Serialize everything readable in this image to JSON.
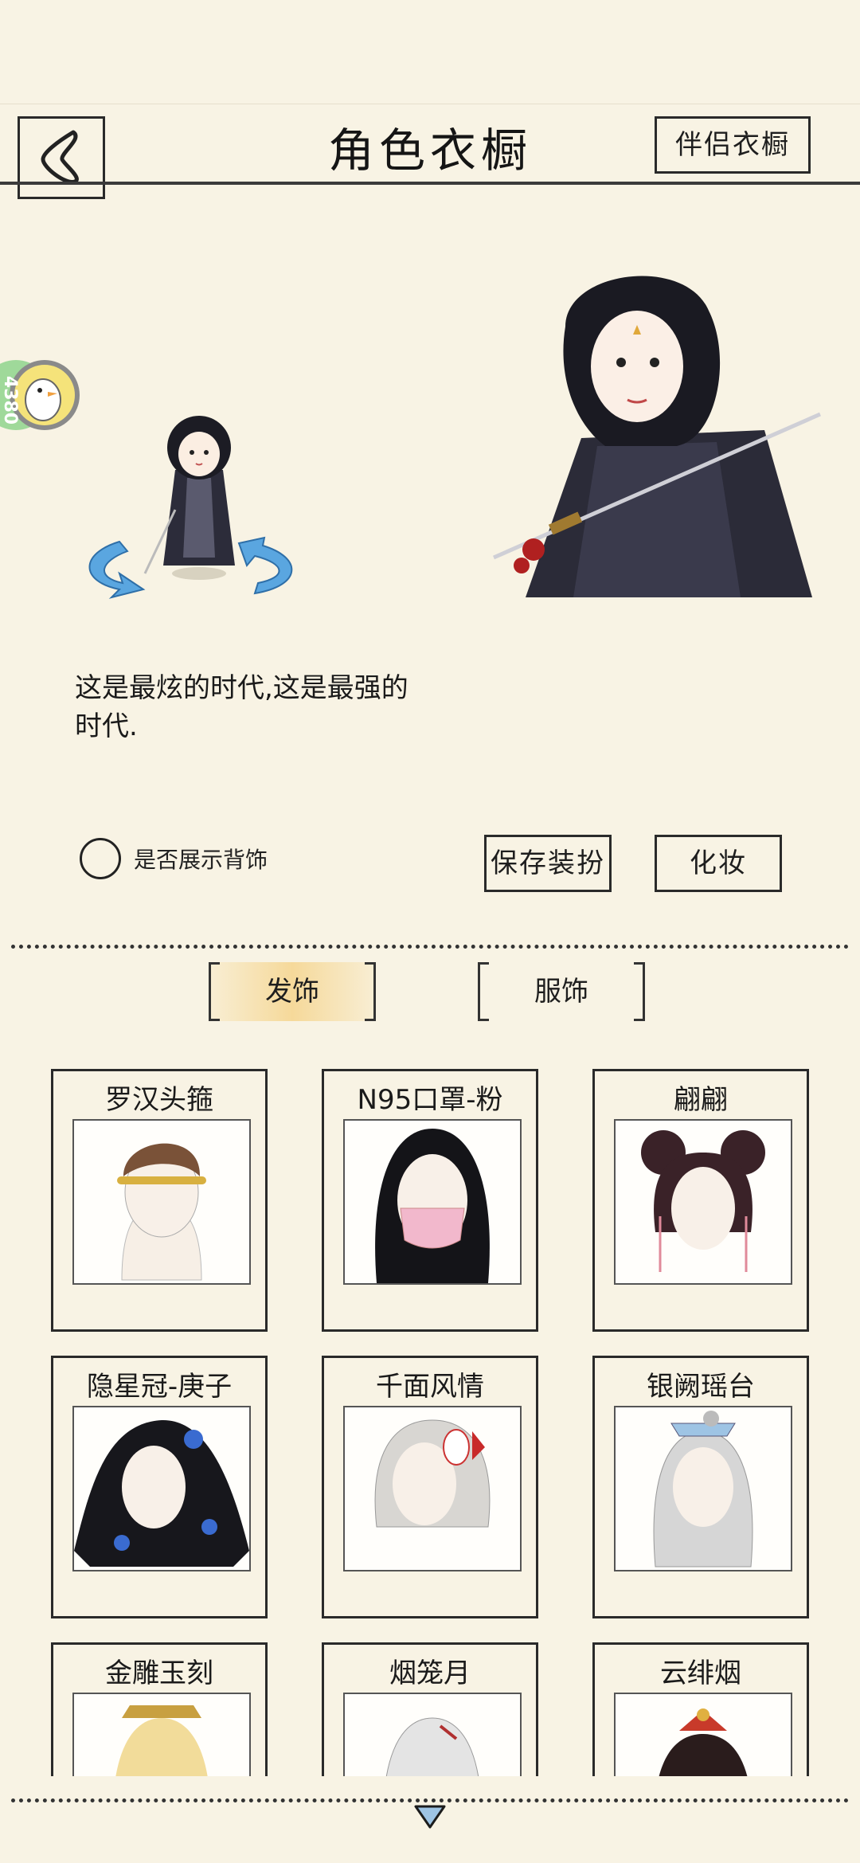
{
  "header": {
    "title": "角色衣橱",
    "partner_wardrobe_label": "伴侣衣橱"
  },
  "float_badge": {
    "text": "4380"
  },
  "description": "这是最炫的时代,这是最强的时代.",
  "options": {
    "show_back_accessory_label": "是否展示背饰",
    "show_back_accessory_checked": false
  },
  "actions": {
    "save_outfit_label": "保存装扮",
    "makeup_label": "化妆"
  },
  "tabs": [
    {
      "label": "发饰",
      "active": true
    },
    {
      "label": "服饰",
      "active": false
    }
  ],
  "items": [
    {
      "name": "罗汉头箍"
    },
    {
      "name": "N95口罩-粉"
    },
    {
      "name": "翩翩"
    },
    {
      "name": "隐星冠-庚子"
    },
    {
      "name": "千面风情"
    },
    {
      "name": "银阙瑶台"
    },
    {
      "name": "金雕玉刻"
    },
    {
      "name": "烟笼月"
    },
    {
      "name": "云绯烟"
    }
  ],
  "colors": {
    "background": "#f8f3e4",
    "ink": "#2a2a2a",
    "active_tab": "#f6d99a",
    "arrow_blue": "#5aa6e0"
  }
}
